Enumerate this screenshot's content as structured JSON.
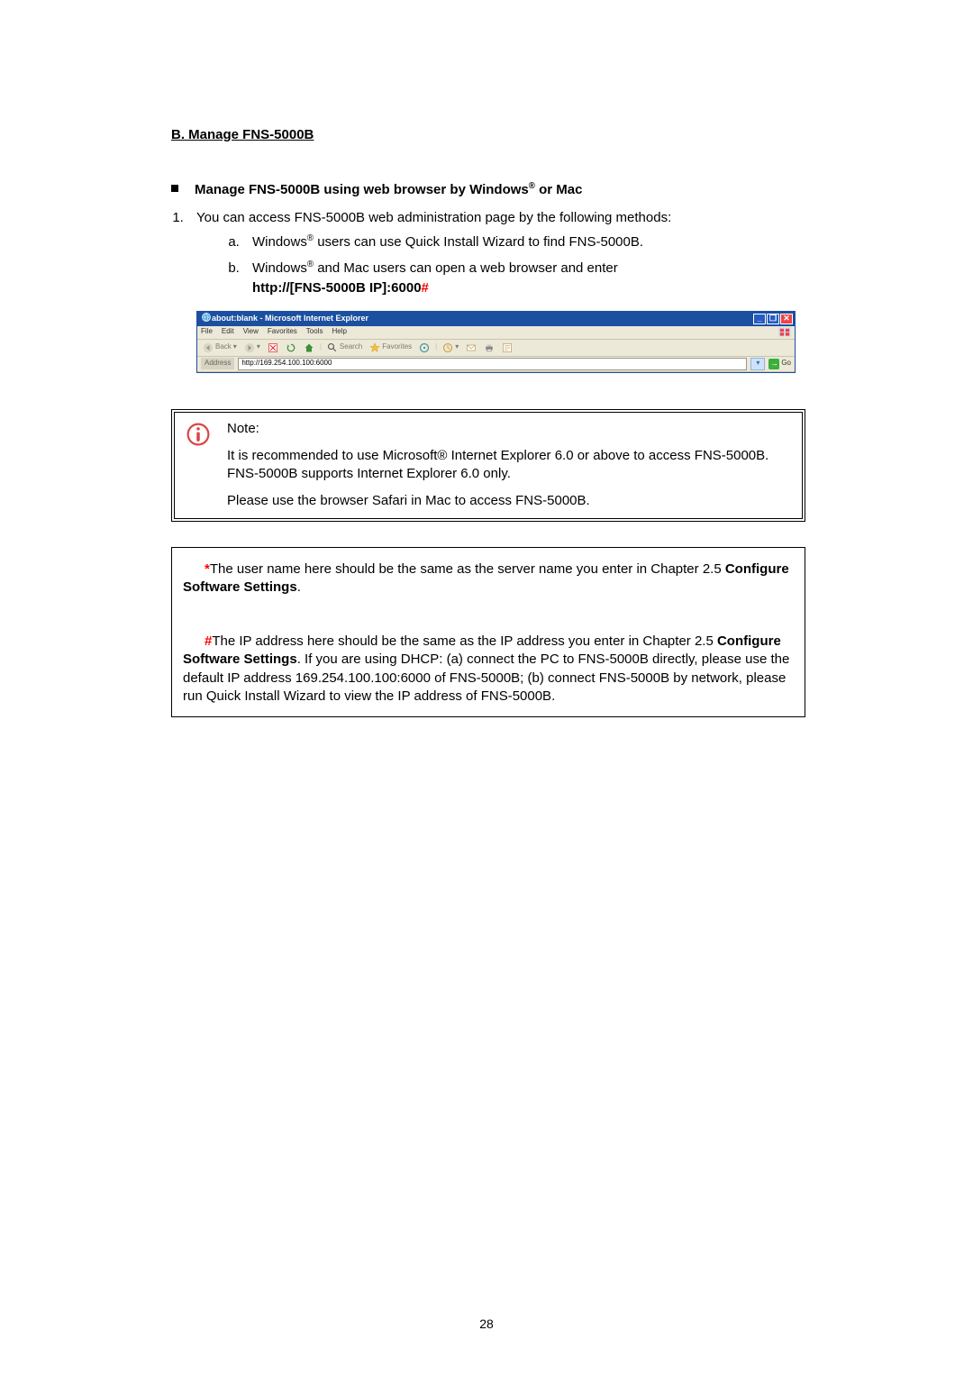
{
  "section_title": "B. Manage FNS-5000B",
  "bullet_heading_pre": "Manage FNS-5000B using web browser by Windows",
  "bullet_heading_post": " or Mac",
  "intro_line": "You can access FNS-5000B web administration page by the following methods:",
  "sub_a_pre": "Windows",
  "sub_a_post": " users can use Quick Install Wizard to find FNS-5000B.",
  "sub_b_pre": "Windows",
  "sub_b_post": " and Mac users can open a web browser and enter",
  "url_bold": "http://[FNS-5000B IP]:6000",
  "hash": "#",
  "ie": {
    "title": "about:blank - Microsoft Internet Explorer",
    "menus": [
      "File",
      "Edit",
      "View",
      "Favorites",
      "Tools",
      "Help"
    ],
    "back": "Back",
    "search": "Search",
    "favorites": "Favorites",
    "address_label": "Address",
    "address_value": "http://169.254.100.100:6000",
    "go": "Go"
  },
  "note": {
    "title": "Note:",
    "p1": "It is recommended to use Microsoft® Internet Explorer 6.0 or above to access FNS-5000B. FNS-5000B supports Internet Explorer 6.0 only.",
    "p2": "Please use the browser Safari in Mac to access FNS-5000B."
  },
  "info1_star": "*",
  "info1_text_a": "The user name here should be the same as the server name you enter in Chapter 2.5 ",
  "info1_bold": "Configure Software Settings",
  "info1_text_b": ".",
  "info2_hash": "#",
  "info2_text_a": "The IP address here should be the same as the IP address you enter in Chapter 2.5 ",
  "info2_bold": "Configure Software Settings",
  "info2_text_b": ".  If you are using DHCP: (a) connect the PC to FNS-5000B directly, please use the default IP address 169.254.100.100:6000 of FNS-5000B; (b) connect FNS-5000B by network, please run Quick Install Wizard to view the IP address of FNS-5000B.",
  "page_number": "28"
}
